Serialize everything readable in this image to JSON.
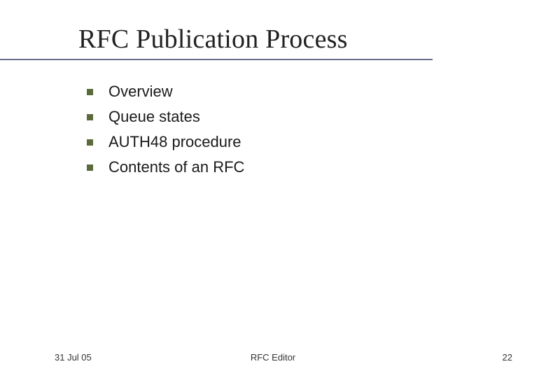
{
  "title": "RFC Publication Process",
  "bullets": {
    "items": [
      {
        "label": "Overview"
      },
      {
        "label": "Queue states"
      },
      {
        "label": "AUTH48 procedure"
      },
      {
        "label": "Contents of an RFC"
      }
    ]
  },
  "footer": {
    "date": "31 Jul 05",
    "center": "RFC Editor",
    "page": "22"
  }
}
